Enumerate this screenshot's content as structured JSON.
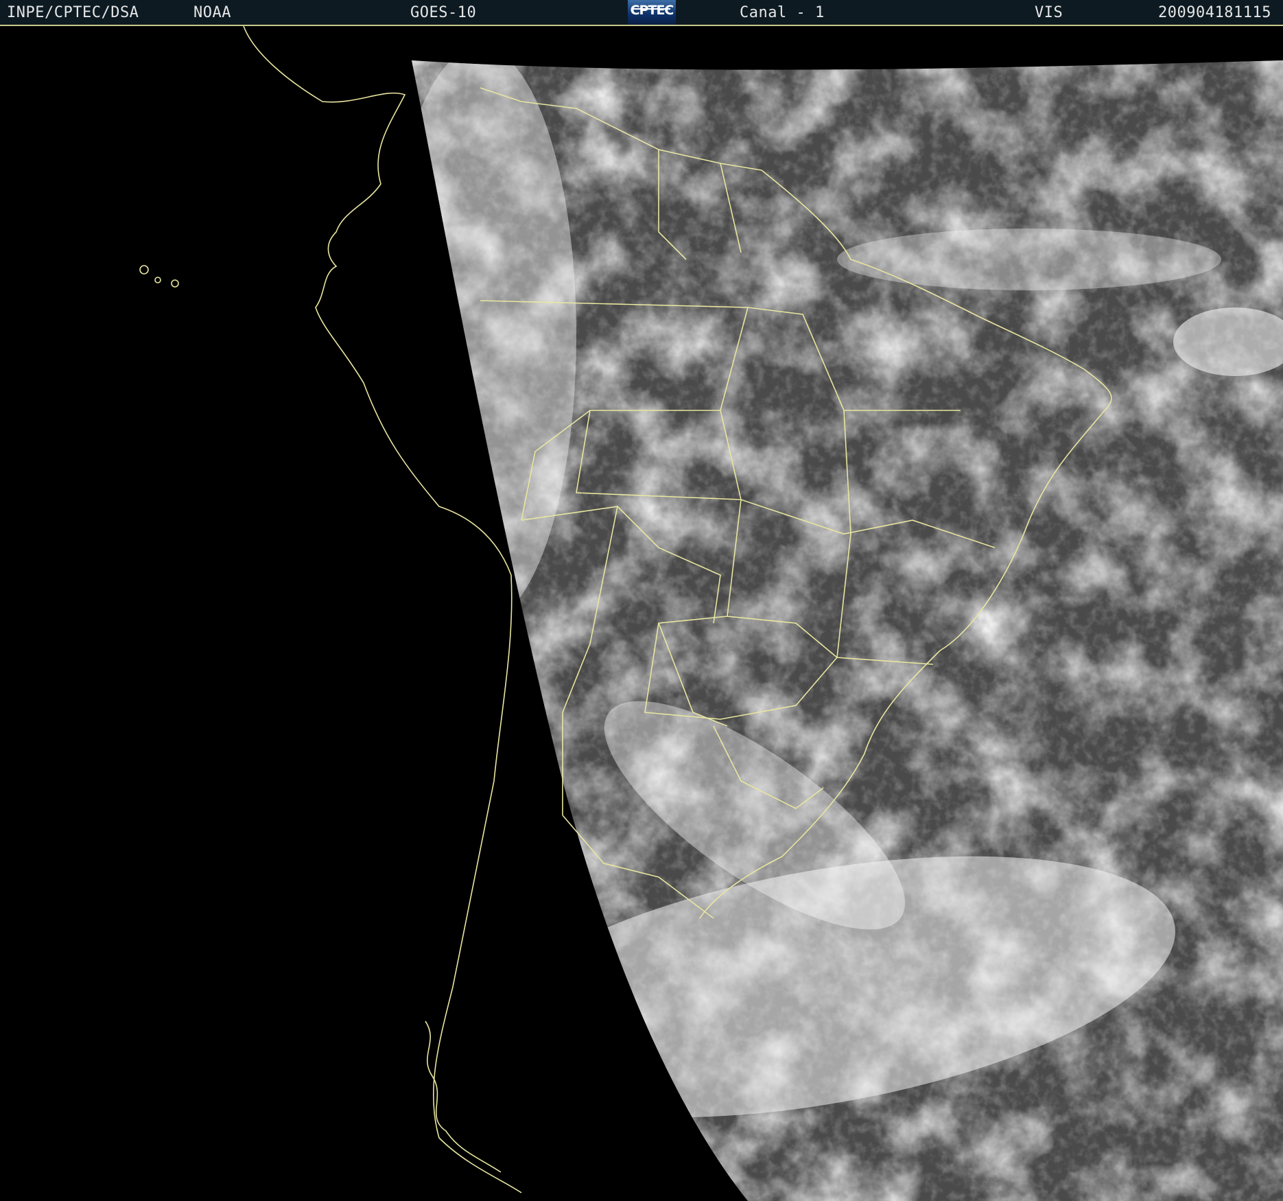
{
  "header": {
    "agency": "INPE/CPTEC/DSA",
    "source": "NOAA",
    "satellite": "GOES-10",
    "logo_text": "CPTEC",
    "channel": "Canal - 1",
    "band": "VIS",
    "timestamp": "200904181115"
  },
  "colors": {
    "header_bg": "#0d1a22",
    "header_text": "#e6e6e6",
    "boundary_lines": "#e8e6a0",
    "background": "#000000"
  },
  "map": {
    "type": "satellite visible imagery",
    "region": "South America",
    "overlay": "country and state boundaries"
  }
}
